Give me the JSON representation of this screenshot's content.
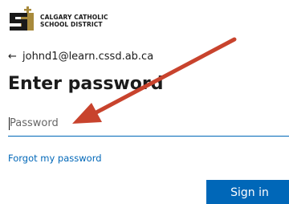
{
  "org": {
    "line1": "CALGARY CATHOLIC",
    "line2": "SCHOOL DISTRICT",
    "colors": {
      "gold": "#a88a3c",
      "dark": "#1a1a1a"
    }
  },
  "identity": {
    "back_icon": "←",
    "email": "johnd1@learn.cssd.ab.ca"
  },
  "title": "Enter password",
  "password": {
    "placeholder": "Password",
    "value": ""
  },
  "links": {
    "forgot": "Forgot my password"
  },
  "buttons": {
    "signin": "Sign in"
  },
  "colors": {
    "accent": "#0067b8",
    "text": "#1b1b1b",
    "annotation_arrow": "#c8432d"
  }
}
